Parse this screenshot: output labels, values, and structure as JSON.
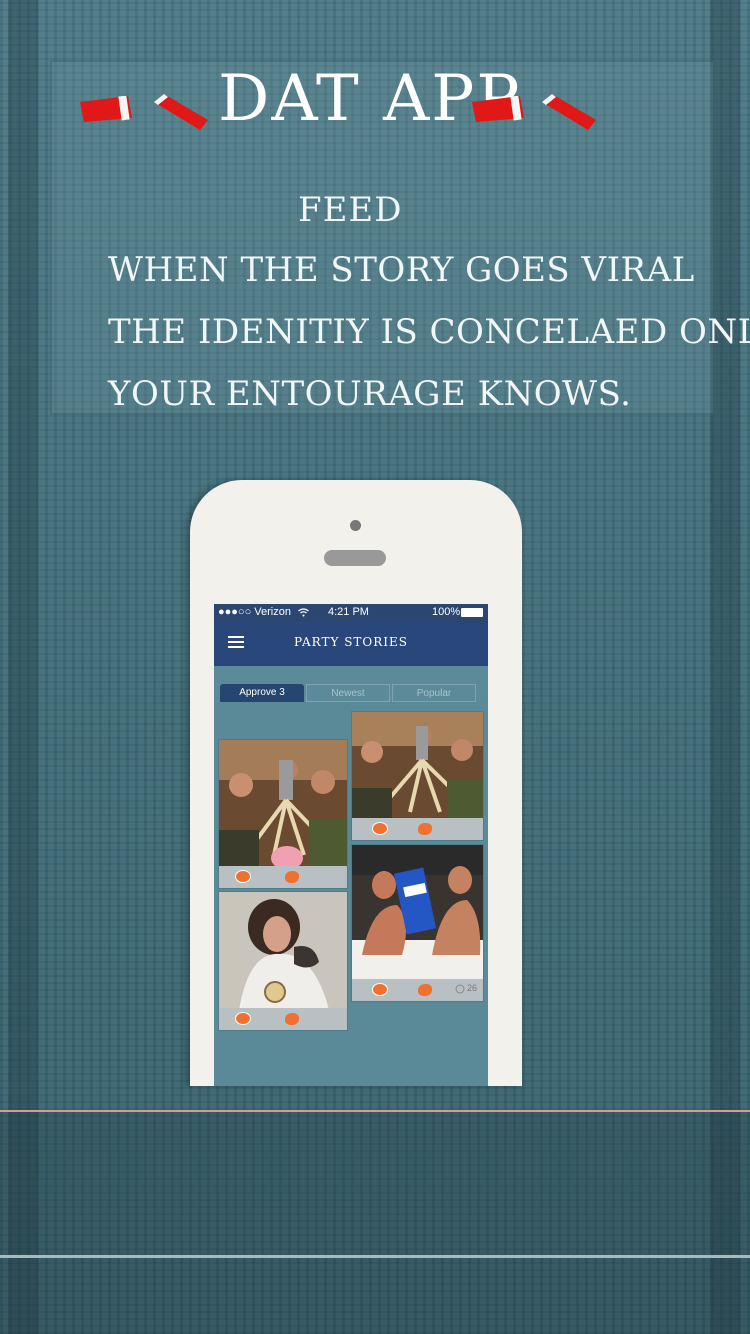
{
  "header": {
    "app_title": "DAT APP",
    "subtitle": "FEED",
    "description_lines": [
      "WHEN THE STORY GOES VIRAL",
      "THE IDENITIY IS CONCELAED ONLY",
      "YOUR ENTOURAGE KNOWS."
    ]
  },
  "phone": {
    "status_bar": {
      "carrier": "●●●○○ Verizon",
      "time": "4:21 PM",
      "battery": "100%"
    },
    "nav": {
      "title": "PARTY STORIES"
    },
    "tabs": [
      {
        "label": "Approve 3",
        "active": true
      },
      {
        "label": "Newest",
        "active": false
      },
      {
        "label": "Popular",
        "active": false
      }
    ],
    "feed_cards": [
      {
        "comment_count": ""
      },
      {
        "comment_count": ""
      },
      {
        "comment_count": ""
      },
      {
        "comment_count": "26"
      }
    ]
  },
  "colors": {
    "background": "#3f6d79",
    "nav_bar": "#29477a",
    "accent_orange": "#f07030",
    "cup_red": "#e01818"
  },
  "icons": [
    "red-cup-icon",
    "hamburger-menu-icon",
    "wifi-icon",
    "like-dot-icon",
    "splat-icon",
    "comment-icon"
  ]
}
